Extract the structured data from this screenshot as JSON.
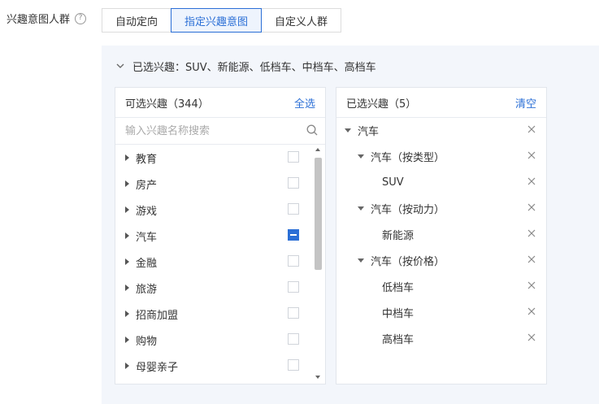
{
  "field": {
    "label": "兴趣意图人群",
    "help_icon": "?"
  },
  "tabs": [
    {
      "label": "自动定向",
      "active": false
    },
    {
      "label": "指定兴趣意图",
      "active": true
    },
    {
      "label": "自定义人群",
      "active": false
    }
  ],
  "summary": {
    "prefix": "已选兴趣：",
    "items": "SUV、新能源、低档车、中档车、高档车"
  },
  "available": {
    "title": "可选兴趣（344）",
    "select_all": "全选",
    "search_placeholder": "输入兴趣名称搜索",
    "items": [
      {
        "label": "教育",
        "state": "unchecked"
      },
      {
        "label": "房产",
        "state": "unchecked"
      },
      {
        "label": "游戏",
        "state": "unchecked"
      },
      {
        "label": "汽车",
        "state": "partial"
      },
      {
        "label": "金融",
        "state": "unchecked"
      },
      {
        "label": "旅游",
        "state": "unchecked"
      },
      {
        "label": "招商加盟",
        "state": "unchecked"
      },
      {
        "label": "购物",
        "state": "unchecked"
      },
      {
        "label": "母婴亲子",
        "state": "unchecked"
      }
    ]
  },
  "selected": {
    "title": "已选兴趣（5）",
    "clear": "清空",
    "tree": [
      {
        "label": "汽车",
        "level": 0,
        "expandable": true
      },
      {
        "label": "汽车（按类型）",
        "level": 1,
        "expandable": true
      },
      {
        "label": "SUV",
        "level": 2,
        "expandable": false
      },
      {
        "label": "汽车（按动力）",
        "level": 1,
        "expandable": true
      },
      {
        "label": "新能源",
        "level": 2,
        "expandable": false
      },
      {
        "label": "汽车（按价格）",
        "level": 1,
        "expandable": true
      },
      {
        "label": "低档车",
        "level": 2,
        "expandable": false
      },
      {
        "label": "中档车",
        "level": 2,
        "expandable": false
      },
      {
        "label": "高档车",
        "level": 2,
        "expandable": false
      }
    ]
  },
  "colors": {
    "accent": "#2b6fd6",
    "panel_bg": "#f3f6fb",
    "border": "#e2e6ec"
  }
}
